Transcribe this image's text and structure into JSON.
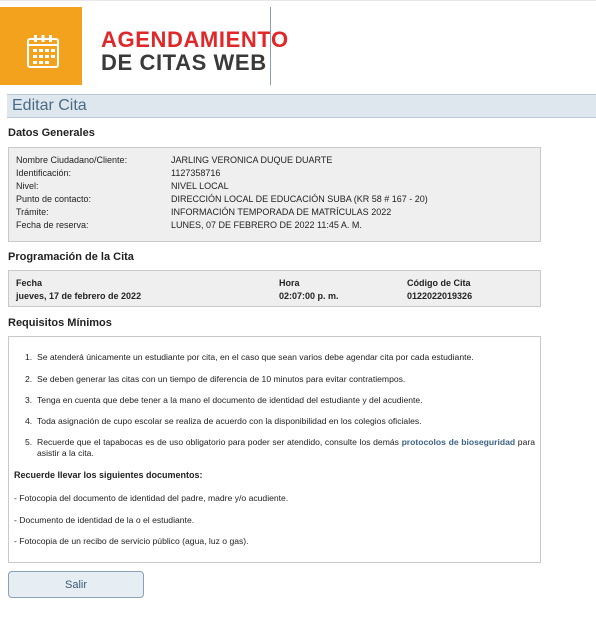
{
  "brand": {
    "line1": "AGENDAMIENTO",
    "line2": "DE CITAS WEB",
    "icon": "calendar-icon",
    "orange": "#f2a21d",
    "red": "#e0272a"
  },
  "page_title": "Editar Cita",
  "datos_generales": {
    "title": "Datos Generales",
    "fields": [
      {
        "label": "Nombre Ciudadano/Cliente:",
        "value": "JARLING VERONICA DUQUE DUARTE"
      },
      {
        "label": "Identificación:",
        "value": "1127358716"
      },
      {
        "label": "Nivel:",
        "value": "NIVEL LOCAL"
      },
      {
        "label": "Punto de contacto:",
        "value": "DIRECCIÓN LOCAL DE EDUCACIÓN SUBA (KR 58 # 167 - 20)"
      },
      {
        "label": "Trámite:",
        "value": "INFORMACIÓN TEMPORADA DE MATRÍCULAS 2022"
      },
      {
        "label": "Fecha de reserva:",
        "value": "LUNES, 07 DE FEBRERO DE 2022 11:45 A. M."
      }
    ]
  },
  "programacion": {
    "title": "Programación de la Cita",
    "fecha_label": "Fecha",
    "fecha_value": "jueves, 17 de febrero de 2022",
    "hora_label": "Hora",
    "hora_value": "02:07:00 p. m.",
    "codigo_label": "Código de Cita",
    "codigo_value": "0122022019326"
  },
  "requisitos": {
    "title": "Requisitos Mínimos",
    "items": [
      {
        "num": "1.",
        "text": "Se atenderá únicamente un estudiante por cita, en el caso que sean varios debe agendar cita por cada estudiante."
      },
      {
        "num": "2.",
        "text": "Se deben generar las citas con un tiempo de diferencia de 10 minutos para evitar contratiempos."
      },
      {
        "num": "3.",
        "text": "Tenga en cuenta que debe tener a la mano el documento de identidad del estudiante y del acudiente."
      },
      {
        "num": "4.",
        "text": "Toda asignación de cupo escolar se realiza de acuerdo con la disponibilidad en los colegios oficiales."
      },
      {
        "num": "5.",
        "text_before": "Recuerde que el tapabocas es de uso obligatorio para poder ser atendido, consulte los demás",
        "link": "protocolos de bioseguridad",
        "text_after": "para asistir a la cita."
      }
    ],
    "docs_title": "Recuerde llevar los siguientes documentos:",
    "docs": [
      "- Fotocopia del documento de identidad del padre, madre y/o acudiente.",
      "- Documento de identidad de la o el estudiante.",
      "- Fotocopia de un recibo de servicio público (agua, luz o gas)."
    ]
  },
  "salir_label": "Salir"
}
